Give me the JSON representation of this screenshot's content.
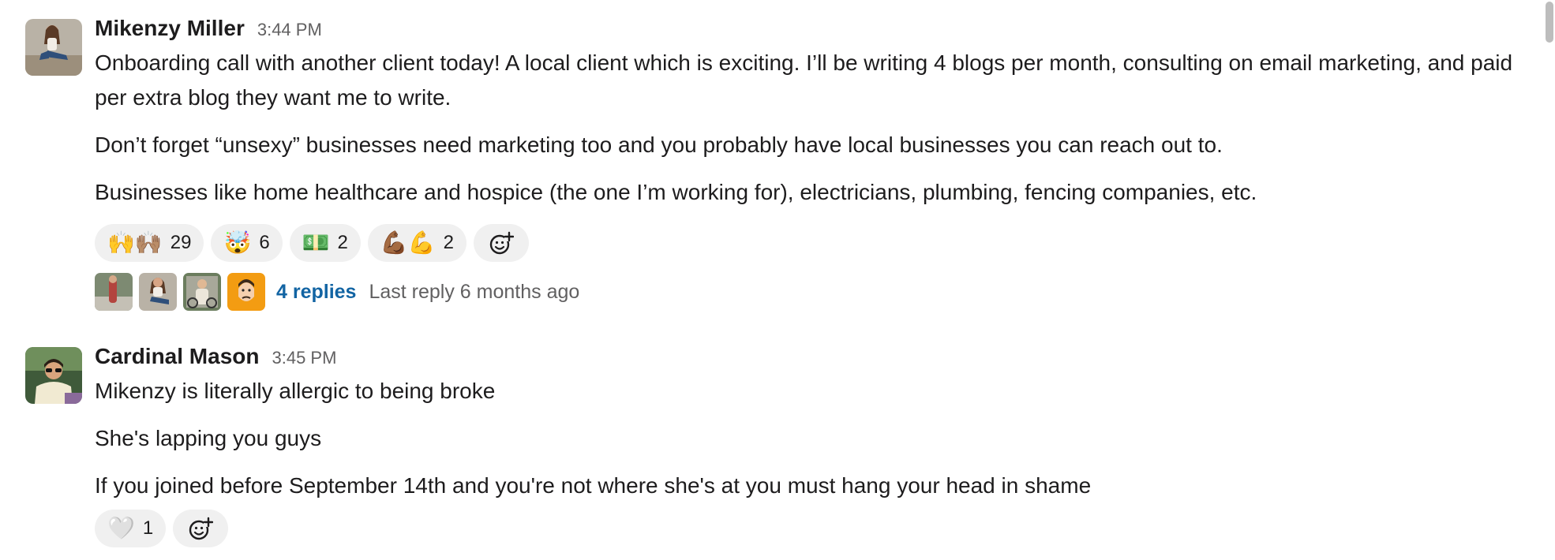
{
  "messages": [
    {
      "author": "Mikenzy Miller",
      "time": "3:44 PM",
      "paragraphs": [
        "Onboarding call with another client today! A local  client which is exciting. I’ll be writing 4 blogs per month, consulting on email marketing, and paid per extra blog they want me to write.",
        "Don’t forget “unsexy” businesses need marketing too and you probably have local businesses you can reach out to.",
        "Businesses like home healthcare and hospice (the one I’m working for), electricians, plumbing, fencing companies, etc."
      ],
      "reactions": [
        {
          "emoji": "🙌🙌🏽",
          "icon": "raised-hands-icon",
          "count": "29"
        },
        {
          "emoji": "🤯",
          "icon": "mind-blown-icon",
          "count": "6"
        },
        {
          "emoji": "💵",
          "icon": "money-icon",
          "count": "2"
        },
        {
          "emoji": "💪🏾💪",
          "icon": "flexed-biceps-icon",
          "count": "2"
        }
      ],
      "thread": {
        "replies": "4 replies",
        "last_reply": "Last reply 6 months ago"
      }
    },
    {
      "author": "Cardinal Mason",
      "time": "3:45 PM",
      "paragraphs": [
        "Mikenzy is literally allergic to being broke",
        "She's lapping you guys",
        "If you joined before September 14th and you're not where she's at you must hang your head in shame"
      ],
      "reactions": [
        {
          "emoji": "🤍",
          "icon": "white-heart-icon",
          "count": "1"
        }
      ]
    }
  ],
  "colors": {
    "link": "#1264a3",
    "muted": "#616061",
    "reaction_bg": "#f0f0f0",
    "text": "#1d1c1d"
  }
}
